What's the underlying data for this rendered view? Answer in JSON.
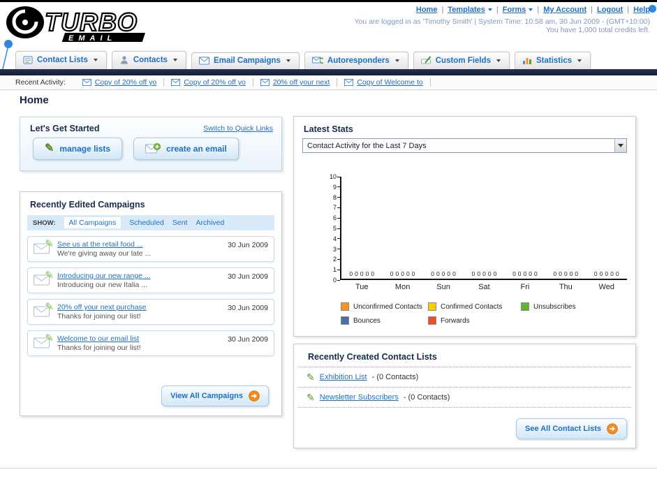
{
  "icons": {
    "pencil": "✎"
  },
  "header": {
    "logo_text": "TURBO",
    "logo_sub": "EMAIL",
    "nav_links": [
      "Home",
      "Templates",
      "Forms",
      "My Account",
      "Logout",
      "Help"
    ],
    "login_info": "You are logged in as 'Timothy Smith' | System Time: 10:58 am, 30 Jun 2009 - (GMT+10:00)",
    "credits_info": "You have 1,000 total credits left."
  },
  "main_nav": {
    "tabs": [
      {
        "label": "Contact Lists"
      },
      {
        "label": "Contacts"
      },
      {
        "label": "Email Campaigns"
      },
      {
        "label": "Autoresponders"
      },
      {
        "label": "Custom Fields"
      },
      {
        "label": "Statistics"
      }
    ]
  },
  "recent_activity": {
    "label": "Recent Activity:",
    "items": [
      "Copy of 20% off yo",
      "Copy of 20% off yo",
      "20% off your next",
      "Copy of Welcome to"
    ]
  },
  "page_title": "Home",
  "get_started": {
    "title": "Let's Get Started",
    "switch_link": "Switch to Quick Links",
    "manage_lists_label": "manage lists",
    "create_email_label": "create an email"
  },
  "campaigns": {
    "title": "Recently Edited Campaigns",
    "show_label": "SHOW:",
    "filters": [
      "All Campaigns",
      "Scheduled",
      "Sent",
      "Archived"
    ],
    "active_filter": "All Campaigns",
    "items": [
      {
        "title": "See us at the retail food ...",
        "subtitle": "We're giving away our late ...",
        "date": "30 Jun 2009"
      },
      {
        "title": "Introducing our new range ...",
        "subtitle": "Introducing our new Italia ...",
        "date": "30 Jun 2009"
      },
      {
        "title": "20% off your next purchase",
        "subtitle": "Thanks for joining our list!",
        "date": "30 Jun 2009"
      },
      {
        "title": "Welcome to our email list",
        "subtitle": "Thanks for joining our list!",
        "date": "30 Jun 2009"
      }
    ],
    "view_all_label": "View All Campaigns"
  },
  "latest_stats": {
    "title": "Latest Stats",
    "dropdown_value": "Contact Activity for the Last 7 Days"
  },
  "chart_data": {
    "type": "bar",
    "categories": [
      "Tue",
      "Mon",
      "Sun",
      "Sat",
      "Fri",
      "Thu",
      "Wed"
    ],
    "series": [
      {
        "name": "Unconfirmed Contacts",
        "color": "#F7941D",
        "values": [
          0,
          0,
          0,
          0,
          0,
          0,
          0
        ]
      },
      {
        "name": "Confirmed Contacts",
        "color": "#FFCC00",
        "values": [
          0,
          0,
          0,
          0,
          0,
          0,
          0
        ]
      },
      {
        "name": "Unsubscribes",
        "color": "#5CB82E",
        "values": [
          0,
          0,
          0,
          0,
          0,
          0,
          0
        ]
      },
      {
        "name": "Bounces",
        "color": "#4A6FA5",
        "values": [
          0,
          0,
          0,
          0,
          0,
          0,
          0
        ]
      },
      {
        "name": "Forwards",
        "color": "#E8502A",
        "values": [
          0,
          0,
          0,
          0,
          0,
          0,
          0
        ]
      }
    ],
    "ylim": [
      0,
      10
    ],
    "yticks": [
      0,
      1,
      2,
      3,
      4,
      5,
      6,
      7,
      8,
      9,
      10
    ],
    "grid": false,
    "legend_position": "bottom"
  },
  "contact_lists": {
    "title": "Recently Created Contact Lists",
    "items": [
      {
        "name": "Exhibition List",
        "suffix": " - (0 Contacts)"
      },
      {
        "name": "Newsletter Subscribers",
        "suffix": " - (0 Contacts)"
      }
    ],
    "see_all_label": "See All Contact Lists"
  }
}
